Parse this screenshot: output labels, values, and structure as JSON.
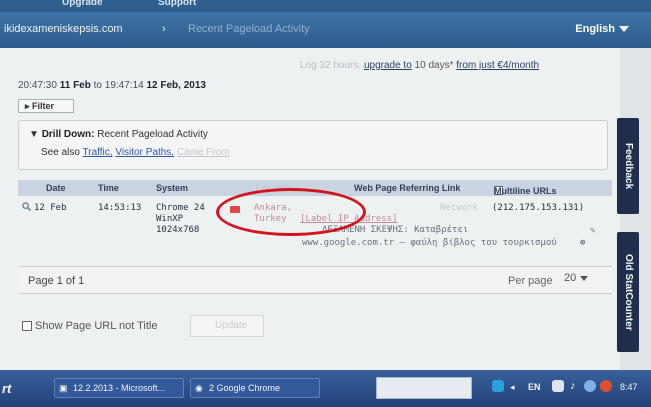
{
  "header": {
    "nav_upgrade": "Upgrade",
    "nav_support": "Support",
    "site": "ikidexameniskepsis.com",
    "crumb_sep": "›",
    "crumb_current": "Recent Pageload Activity",
    "language": "English"
  },
  "upgrade_line": {
    "faint": "Log 32 hours,",
    "link": "upgrade to",
    "middle": "10 days*",
    "link2": "from just €4/month"
  },
  "range": {
    "start_time": "20:47:30",
    "start_date": "11 Feb",
    "to": "to",
    "end_time": "19:47:14",
    "end_date": "12 Feb, 2013"
  },
  "filter_button": "Filter",
  "drill": {
    "label": "Drill Down:",
    "text": "Recent Pageload Activity",
    "see_also": "See also",
    "link_traffic": "Traffic,",
    "link_visitor_paths": "Visitor Paths,",
    "link_came_from": "Came From"
  },
  "table": {
    "headers": [
      "Date",
      "Time",
      "System",
      "Location",
      "Web Page Referring Link"
    ],
    "multiline_label": "Multiline URLs",
    "row": {
      "date": "12 Feb",
      "time": "14:53:13",
      "system_browser": "Chrome 24",
      "system_os": "WinXP",
      "system_res": "1024x768",
      "loc_city": "Ankara,",
      "loc_country": "Turkey",
      "network": "Network",
      "ip": "(212.175.153.131)",
      "label_ip": "[Label IP Address]",
      "page_title": "ΔΕΞΑΜΕΝΗ ΣΚΕΨΗΣ: Καταβρέτει",
      "referrer": "www.google.com.tr — φαύλη βίβλος του τουρκισμού"
    }
  },
  "pager": {
    "page": "Page 1 of 1",
    "per_page": "Per page",
    "per_page_value": "20"
  },
  "options": {
    "show_url": "Show Page URL not Title",
    "update": "Update"
  },
  "sidetabs": {
    "feedback": "Feedback",
    "old_statcounter": "Old StatCounter"
  },
  "taskbar": {
    "start": "rt",
    "item1": "12.2.2013 - Microsoft...",
    "item2": "2 Google Chrome",
    "lang": "EN",
    "clock": "8:47"
  }
}
